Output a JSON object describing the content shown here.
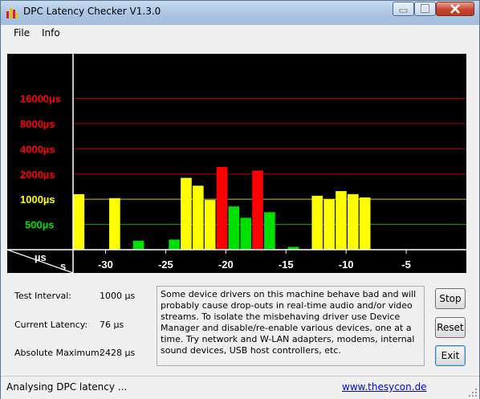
{
  "window": {
    "title": "DPC Latency Checker V1.3.0",
    "controls": [
      "minimize",
      "maximize",
      "close"
    ],
    "icons": {
      "app": "bar-chart-icon",
      "minimize": "minimize-icon",
      "maximize": "maximize-icon",
      "close": "close-icon"
    }
  },
  "menu": {
    "items": [
      "File",
      "Info"
    ]
  },
  "chart_data": {
    "type": "bar",
    "xlabel": "s",
    "ylabel": "µs",
    "scale": "log",
    "ylim": [
      250,
      40000
    ],
    "grid_red": [
      "16000µs",
      "8000µs",
      "4000µs",
      "2000µs"
    ],
    "grid_red_values": [
      16000,
      8000,
      4000,
      2000
    ],
    "grid_yellow": "1000µs",
    "grid_yellow_value": 1000,
    "grid_green": "500µs",
    "grid_green_value": 500,
    "x_ticks": [
      "-30",
      "-25",
      "-20",
      "-15",
      "-10",
      "-5"
    ],
    "x_tick_values": [
      -30,
      -25,
      -20,
      -15,
      -10,
      -5
    ],
    "x_range": [
      -32.7,
      0
    ],
    "bars": [
      {
        "value": 1150,
        "color": "#ffff00"
      },
      {
        "value": 250,
        "color": "#00e000"
      },
      {
        "value": 250,
        "color": "#00e000"
      },
      {
        "value": 1030,
        "color": "#ffff00"
      },
      {
        "value": 250,
        "color": "#00e000"
      },
      {
        "value": 320,
        "color": "#00e000"
      },
      {
        "value": 250,
        "color": "#00e000"
      },
      {
        "value": 250,
        "color": "#00e000"
      },
      {
        "value": 330,
        "color": "#00e000"
      },
      {
        "value": 1800,
        "color": "#ffff00"
      },
      {
        "value": 1450,
        "color": "#ffff00"
      },
      {
        "value": 980,
        "color": "#ffff00"
      },
      {
        "value": 2428,
        "color": "#ff0000"
      },
      {
        "value": 820,
        "color": "#00e000"
      },
      {
        "value": 600,
        "color": "#00e000"
      },
      {
        "value": 2200,
        "color": "#ff0000"
      },
      {
        "value": 700,
        "color": "#00e000"
      },
      {
        "value": 250,
        "color": "#00e000"
      },
      {
        "value": 270,
        "color": "#00e000"
      },
      {
        "value": 250,
        "color": "#00e000"
      },
      {
        "value": 1100,
        "color": "#ffff00"
      },
      {
        "value": 1000,
        "color": "#ffff00"
      },
      {
        "value": 1250,
        "color": "#ffff00"
      },
      {
        "value": 1150,
        "color": "#ffff00"
      },
      {
        "value": 1050,
        "color": "#ffff00"
      },
      {
        "value": 250,
        "color": "#00e000"
      },
      {
        "value": 250,
        "color": "#00e000"
      },
      {
        "value": 250,
        "color": "#00e000"
      },
      {
        "value": 250,
        "color": "#00e000"
      },
      {
        "value": 250,
        "color": "#00e000"
      },
      {
        "value": 250,
        "color": "#00e000"
      },
      {
        "value": 250,
        "color": "#00e000"
      },
      {
        "value": 250,
        "color": "#00e000"
      }
    ]
  },
  "stats": {
    "interval_label": "Test Interval:",
    "interval_value": "1000 µs",
    "current_label": "Current Latency:",
    "current_value": "76 µs",
    "max_label": "Absolute Maximum:",
    "max_value": "2428 µs"
  },
  "info_text": "Some device drivers on this machine behave bad and will probably cause drop-outs in real-time audio and/or video streams. To isolate the misbehaving driver use Device Manager and disable/re-enable various devices, one at a time. Try network and W-LAN adapters, modems, internal sound devices, USB host controllers, etc.",
  "buttons": {
    "stop": "Stop",
    "reset": "Reset",
    "exit": "Exit"
  },
  "status": {
    "text": "Analysing DPC latency ...",
    "link": "www.thesycon.de"
  },
  "colors": {
    "chart_bg": "#000000",
    "red": "#ff0000",
    "yellow": "#ffff00",
    "green": "#00e000",
    "link": "#0000ee"
  }
}
